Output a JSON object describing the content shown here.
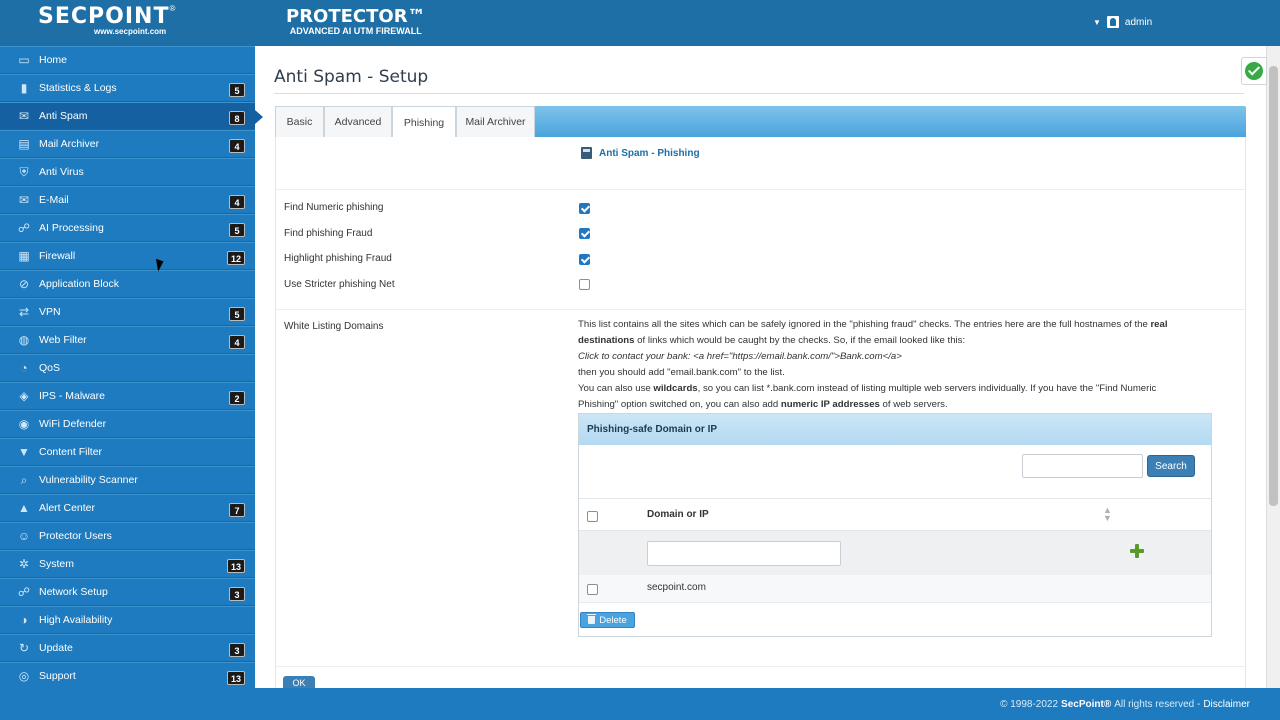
{
  "header": {
    "brand": "SECPOINT",
    "brand_reg": "®",
    "brand_url": "www.secpoint.com",
    "product": "PROTECTOR™",
    "product_sub": "ADVANCED AI UTM FIREWALL",
    "user": "admin"
  },
  "sidebar": {
    "items": [
      {
        "label": "Home",
        "icon": "monitor-icon",
        "badge": ""
      },
      {
        "label": "Statistics & Logs",
        "icon": "bar-chart-icon",
        "badge": "5"
      },
      {
        "label": "Anti Spam",
        "icon": "mail-filter-icon",
        "badge": "8",
        "active": true
      },
      {
        "label": "Mail Archiver",
        "icon": "archive-icon",
        "badge": "4"
      },
      {
        "label": "Anti Virus",
        "icon": "shield-icon",
        "badge": ""
      },
      {
        "label": "E-Mail",
        "icon": "email-icon",
        "badge": "4"
      },
      {
        "label": "AI Processing",
        "icon": "network-icon",
        "badge": "5"
      },
      {
        "label": "Firewall",
        "icon": "firewall-icon",
        "badge": "12"
      },
      {
        "label": "Application Block",
        "icon": "block-icon",
        "badge": ""
      },
      {
        "label": "VPN",
        "icon": "vpn-icon",
        "badge": "5"
      },
      {
        "label": "Web Filter",
        "icon": "globe-icon",
        "badge": "4"
      },
      {
        "label": "QoS",
        "icon": "qos-icon",
        "badge": ""
      },
      {
        "label": "IPS - Malware",
        "icon": "ips-icon",
        "badge": "2"
      },
      {
        "label": "WiFi Defender",
        "icon": "wifi-icon",
        "badge": ""
      },
      {
        "label": "Content Filter",
        "icon": "filter-icon",
        "badge": ""
      },
      {
        "label": "Vulnerability Scanner",
        "icon": "scanner-icon",
        "badge": ""
      },
      {
        "label": "Alert Center",
        "icon": "alert-icon",
        "badge": "7"
      },
      {
        "label": "Protector Users",
        "icon": "users-icon",
        "badge": ""
      },
      {
        "label": "System",
        "icon": "gear-icon",
        "badge": "13"
      },
      {
        "label": "Network Setup",
        "icon": "network-setup-icon",
        "badge": "3"
      },
      {
        "label": "High Availability",
        "icon": "ha-icon",
        "badge": ""
      },
      {
        "label": "Update",
        "icon": "refresh-icon",
        "badge": "3"
      },
      {
        "label": "Support",
        "icon": "support-icon",
        "badge": "13"
      }
    ]
  },
  "main": {
    "title": "Anti Spam - Setup",
    "tabs": [
      "Basic",
      "Advanced",
      "Phishing",
      "Mail Archiver"
    ],
    "active_tab": "Phishing",
    "section_title": "Anti Spam - Phishing",
    "options": [
      {
        "label": "Find Numeric phishing",
        "checked": true
      },
      {
        "label": "Find phishing Fraud",
        "checked": true
      },
      {
        "label": "Highlight phishing Fraud",
        "checked": true
      },
      {
        "label": "Use Stricter phishing Net",
        "checked": false
      }
    ],
    "whitelist_label": "White Listing Domains",
    "desc": {
      "l1a": "This list contains all the sites which can be safely ignored in the \"phishing fraud\" checks. The entries here are the full hostnames of the ",
      "l1b": "real",
      "l2a": "destinations",
      "l2b": " of links which would be caught by the checks. So, if the email looked like this:",
      "l3": "Click to contact your bank: <a href=\"https://email.bank.com/\">Bank.com</a>",
      "l4": "then you should add \"email.bank.com\" to the list.",
      "l5a": "You can also use ",
      "l5b": "wildcards",
      "l5c": ", so you can list *.bank.com instead of listing multiple web servers individually. If you have the \"Find Numeric",
      "l6a": "Phishing\" option switched on, you can also add ",
      "l6b": "numeric IP addresses",
      "l6c": " of web servers."
    },
    "table": {
      "title": "Phishing-safe Domain or IP",
      "search_value": "",
      "search_button": "Search",
      "column": "Domain or IP",
      "new_value": "",
      "rows": [
        "secpoint.com"
      ],
      "delete_button": "Delete"
    },
    "ok_button": "OK"
  },
  "footer": {
    "copy": "© 1998-2022",
    "company": "SecPoint®",
    "rights": "All rights reserved -",
    "disclaimer": "Disclaimer"
  },
  "colors": {
    "header": "#1d6fa5",
    "sidebar": "#1e7bbf",
    "accent": "#3b7fb4"
  }
}
